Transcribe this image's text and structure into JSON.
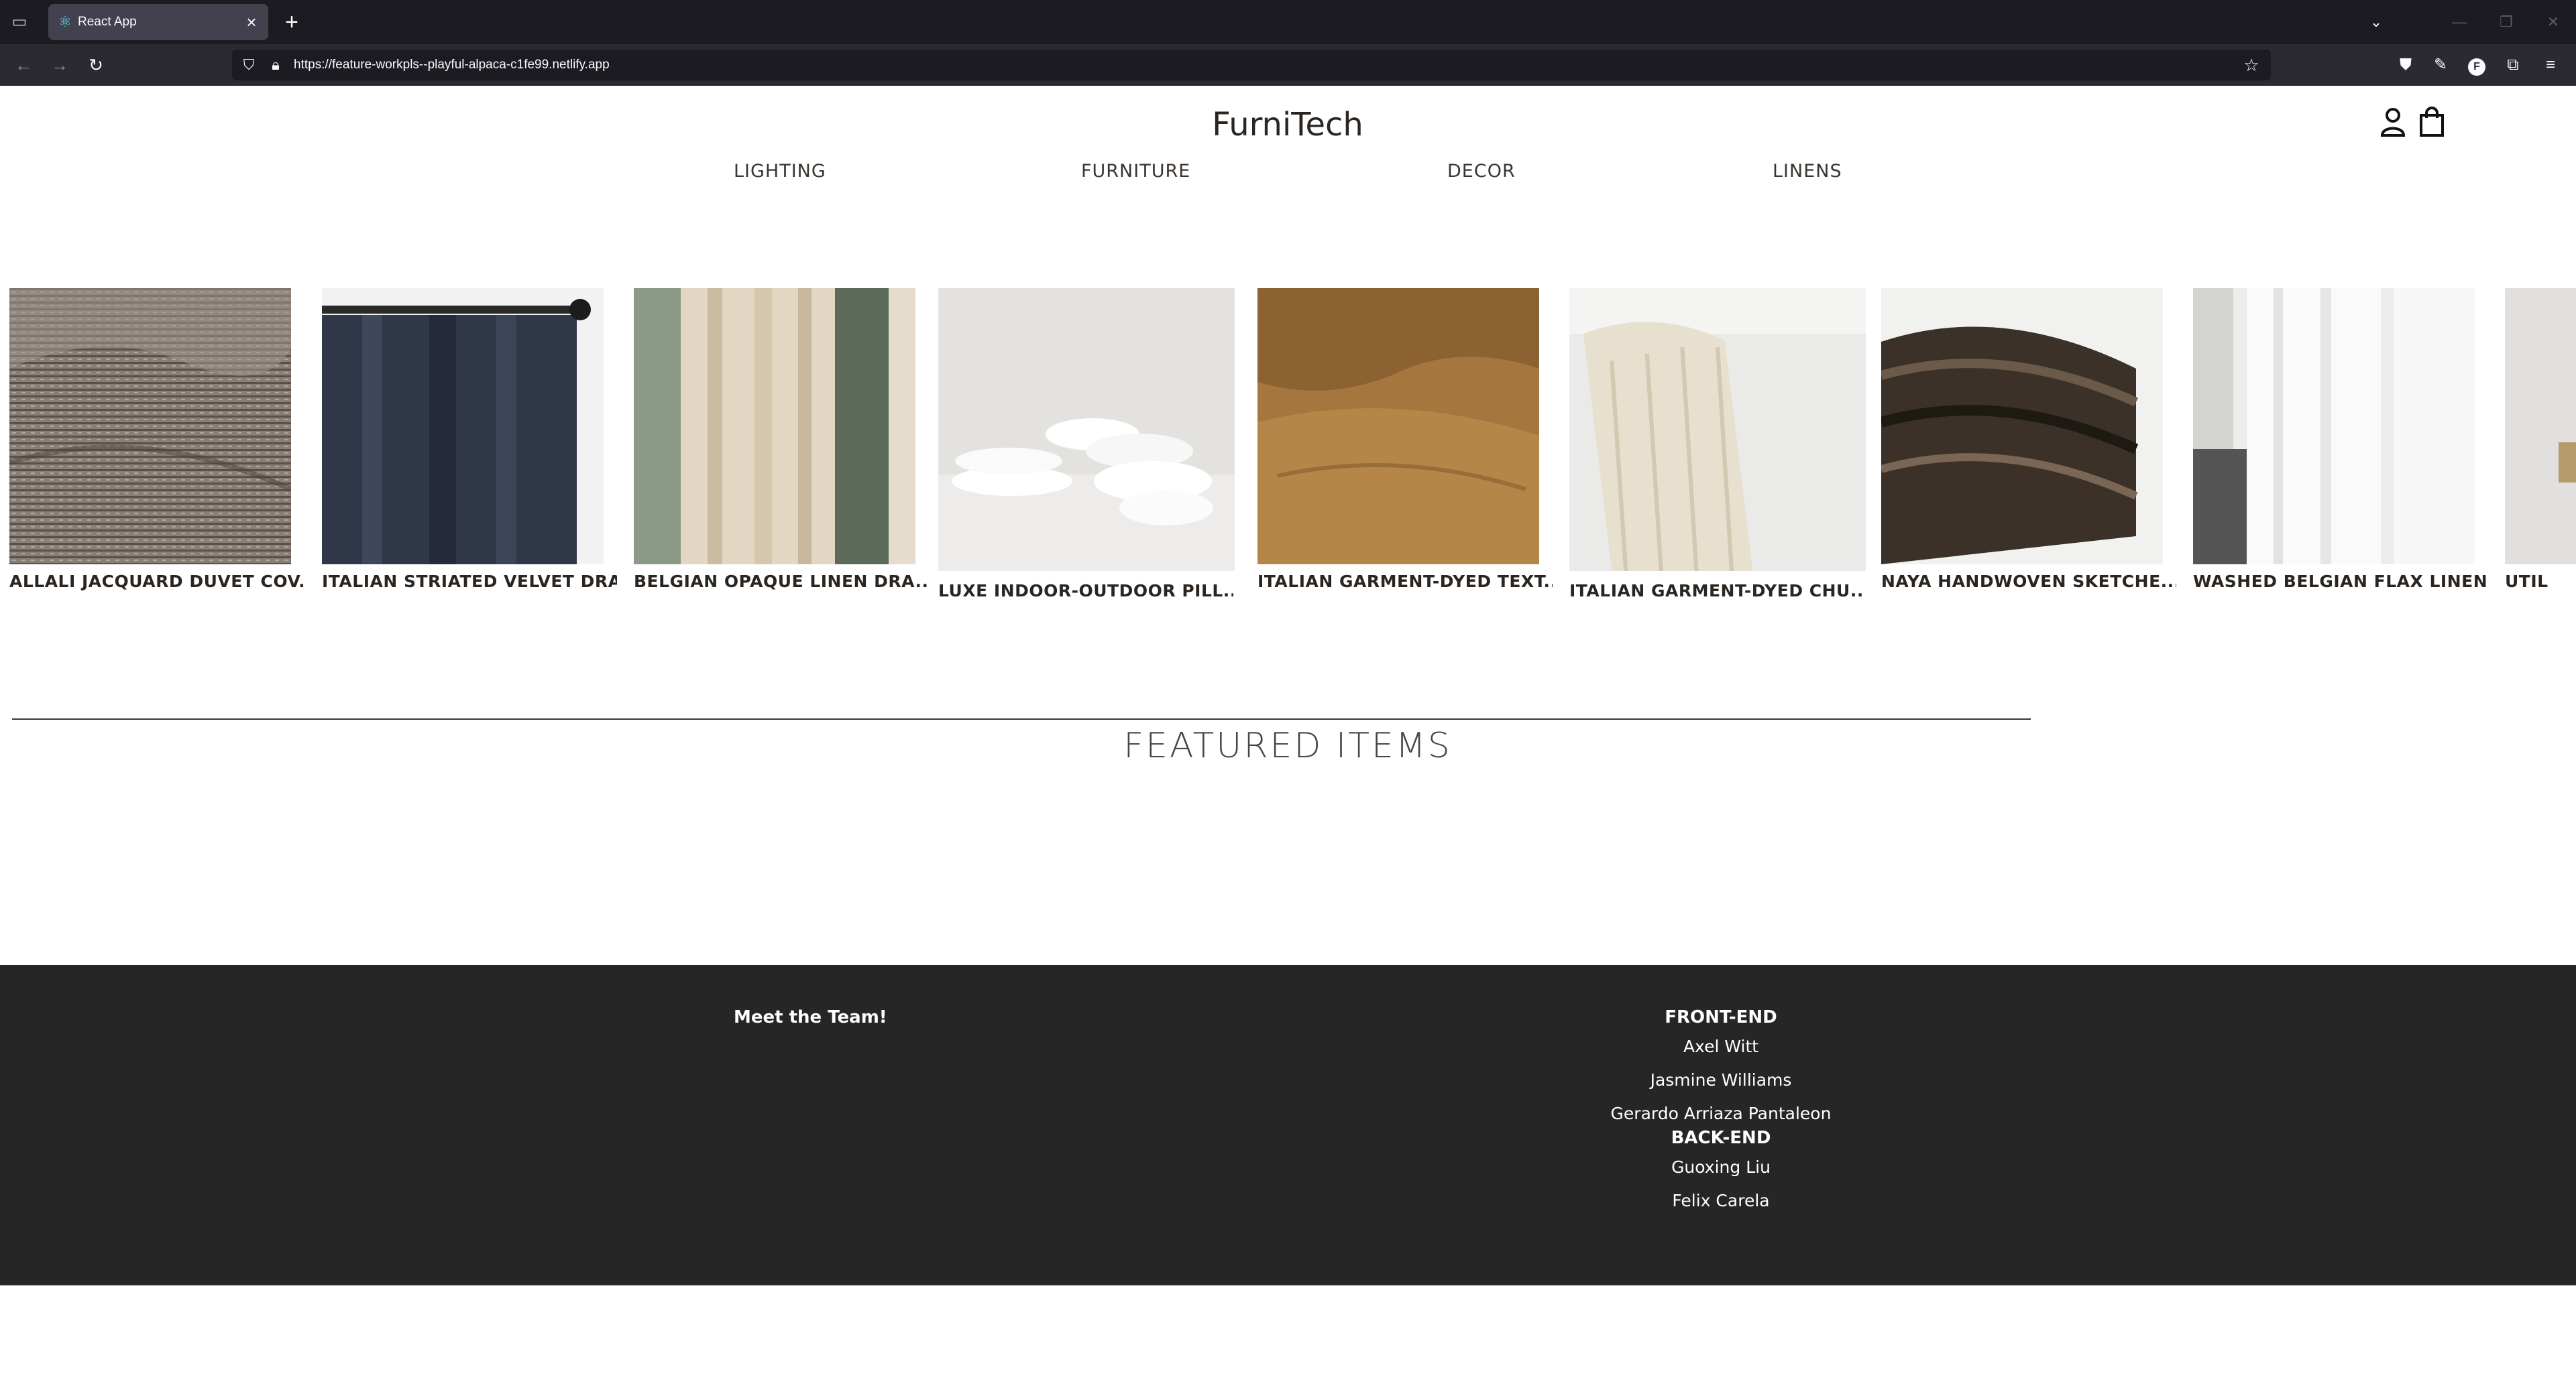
{
  "browser": {
    "tab": {
      "title": "React App"
    },
    "url": "https://feature-workpls--playful-alpaca-c1fe99.netlify.app"
  },
  "site": {
    "brand": "FurniTech",
    "nav": [
      "LIGHTING",
      "FURNITURE",
      "DECOR",
      "LINENS"
    ]
  },
  "carousel": {
    "items": [
      {
        "label": "ALLALI JACQUARD DUVET COV...",
        "image": "grey textured duvet"
      },
      {
        "label": "ITALIAN STRIATED VELVET DRA...",
        "image": "navy velvet drape"
      },
      {
        "label": "BELGIAN OPAQUE LINEN DRA...",
        "image": "beige linen drapes"
      },
      {
        "label": "LUXE INDOOR-OUTDOOR PILL...",
        "image": "white pillows stack"
      },
      {
        "label": "ITALIAN GARMENT-DYED TEXT...",
        "image": "tan textured bedding"
      },
      {
        "label": "ITALIAN GARMENT-DYED CHU...",
        "image": "cream chunky throw"
      },
      {
        "label": "NAYA HANDWOVEN SKETCHE...",
        "image": "dark striped throw"
      },
      {
        "label": "WASHED BELGIAN FLAX LINEN...",
        "image": "white linen curtains"
      },
      {
        "label": "UTIL",
        "image": "partial lamp"
      }
    ]
  },
  "featured": {
    "title": "FEATURED ITEMS"
  },
  "footer": {
    "meet": "Meet the Team!",
    "frontend_heading": "FRONT-END",
    "frontend": [
      "Axel Witt",
      "Jasmine Williams",
      "Gerardo Arriaza Pantaleon"
    ],
    "backend_heading": "BACK-END",
    "backend": [
      "Guoxing Liu",
      "Felix Carela"
    ]
  }
}
